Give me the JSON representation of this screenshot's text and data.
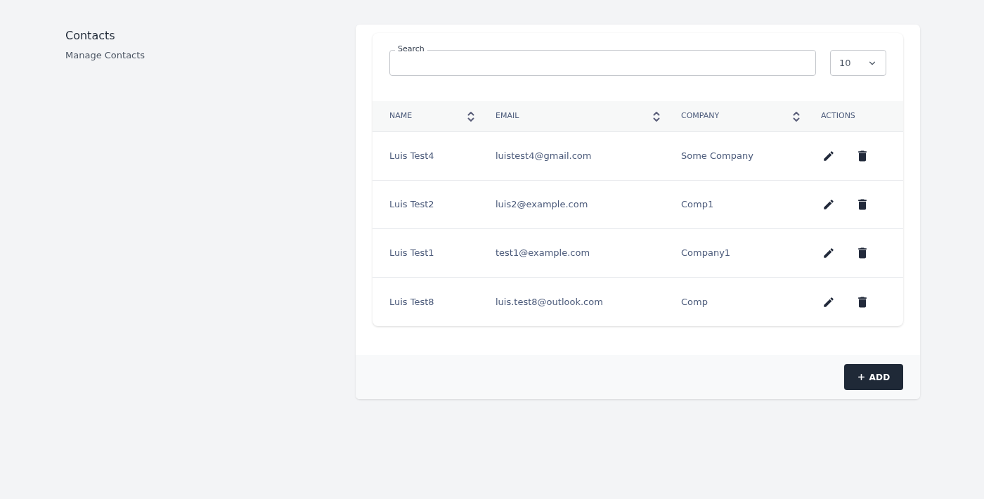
{
  "page": {
    "title": "Contacts",
    "subtitle": "Manage Contacts"
  },
  "search": {
    "label": "Search"
  },
  "page_size": {
    "value": "10"
  },
  "table": {
    "columns": [
      {
        "label": "NAME",
        "sortable": true
      },
      {
        "label": "EMAIL",
        "sortable": true
      },
      {
        "label": "COMPANY",
        "sortable": true
      },
      {
        "label": "ACTIONS",
        "sortable": false
      }
    ],
    "rows": [
      {
        "name": "Luis Test4",
        "email": "luistest4@gmail.com",
        "company": "Some Company"
      },
      {
        "name": "Luis Test2",
        "email": "luis2@example.com",
        "company": "Comp1"
      },
      {
        "name": "Luis Test1",
        "email": "test1@example.com",
        "company": "Company1"
      },
      {
        "name": "Luis Test8",
        "email": "luis.test8@outlook.com",
        "company": "Comp"
      }
    ]
  },
  "add_button": {
    "label": "ADD"
  }
}
